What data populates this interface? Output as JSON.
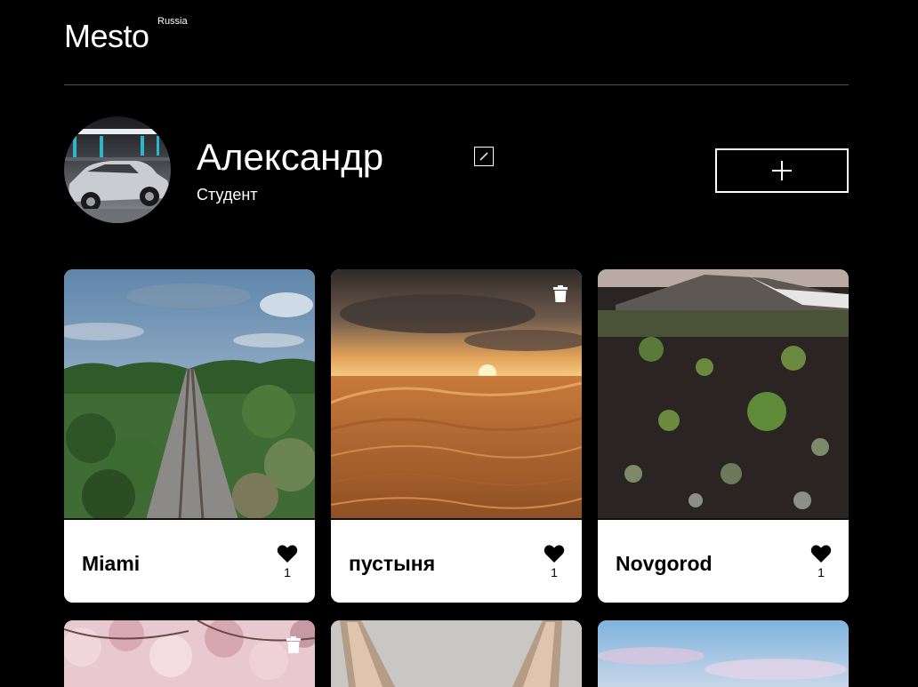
{
  "header": {
    "logo": "Mesto",
    "logo_sup": "Russia"
  },
  "profile": {
    "name": "Александр",
    "about": "Студент",
    "avatar_alt": "avatar-car-photo"
  },
  "icons": {
    "edit": "pencil-icon",
    "add": "plus-icon",
    "like": "heart-icon",
    "delete": "trash-icon"
  },
  "cards": [
    {
      "title": "Miami",
      "likes": "1",
      "deletable": false
    },
    {
      "title": "пустыня",
      "likes": "1",
      "deletable": true
    },
    {
      "title": "Novgorod",
      "likes": "1",
      "deletable": false
    },
    {
      "title": "",
      "likes": "",
      "deletable": true
    },
    {
      "title": "",
      "likes": "",
      "deletable": false
    },
    {
      "title": "",
      "likes": "",
      "deletable": false
    }
  ],
  "colors": {
    "background": "#000000",
    "card": "#ffffff",
    "divider": "#545454"
  }
}
